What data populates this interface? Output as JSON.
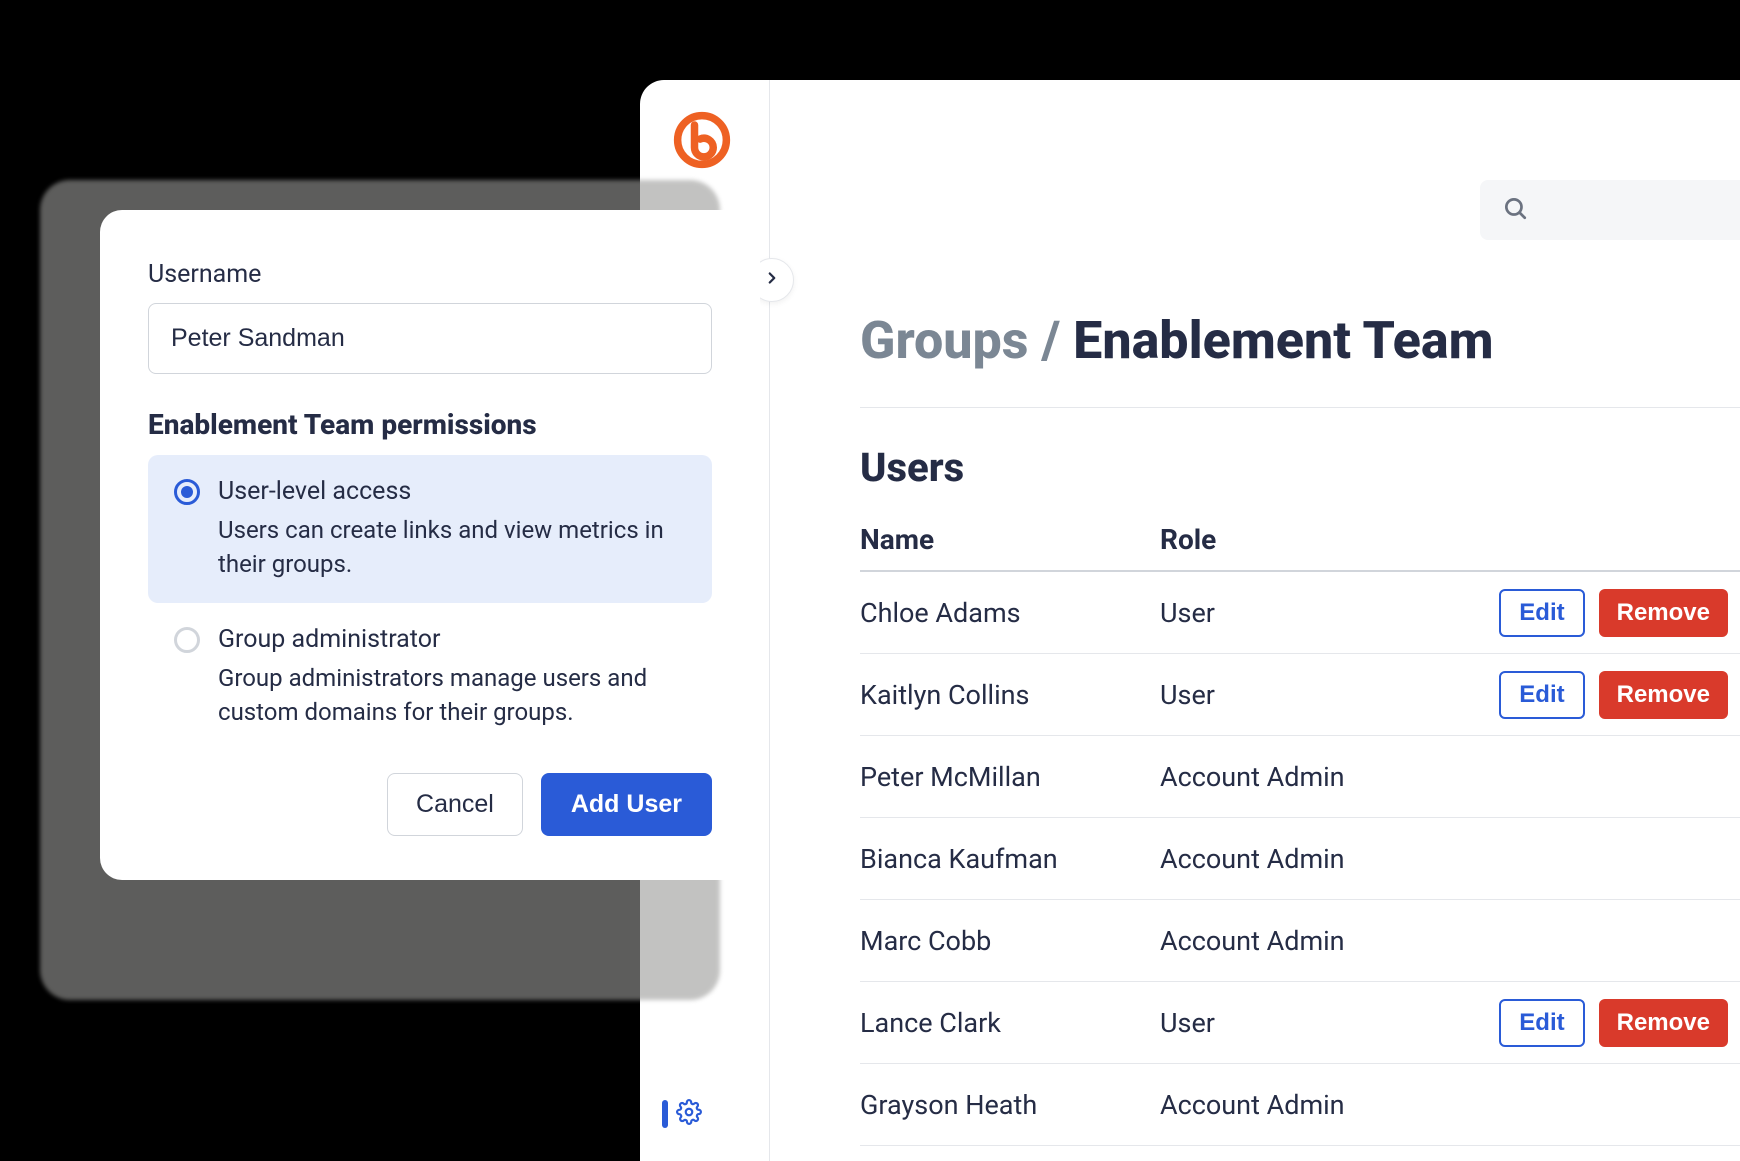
{
  "breadcrumb": {
    "root": "Groups",
    "sep": "/",
    "current": "Enablement Team"
  },
  "section_title": "Users",
  "table": {
    "headers": {
      "name": "Name",
      "role": "Role"
    },
    "edit_label": "Edit",
    "remove_label": "Remove",
    "rows": [
      {
        "name": "Chloe Adams",
        "role": "User",
        "editable": true
      },
      {
        "name": "Kaitlyn Collins",
        "role": "User",
        "editable": true
      },
      {
        "name": "Peter McMillan",
        "role": "Account Admin",
        "editable": false
      },
      {
        "name": "Bianca Kaufman",
        "role": "Account Admin",
        "editable": false
      },
      {
        "name": "Marc Cobb",
        "role": "Account Admin",
        "editable": false
      },
      {
        "name": "Lance Clark",
        "role": "User",
        "editable": true
      },
      {
        "name": "Grayson Heath",
        "role": "Account Admin",
        "editable": false
      }
    ]
  },
  "modal": {
    "username_label": "Username",
    "username_value": "Peter Sandman",
    "permissions_heading": "Enablement Team permissions",
    "options": [
      {
        "title": "User-level access",
        "desc": "Users can create links and view metrics in their groups.",
        "selected": true
      },
      {
        "title": "Group administrator",
        "desc": "Group administrators manage users and custom domains for their groups.",
        "selected": false
      }
    ],
    "cancel_label": "Cancel",
    "submit_label": "Add User"
  },
  "colors": {
    "primary": "#2a5bd7",
    "danger": "#d93a2b",
    "brand": "#ee6123",
    "text": "#252c45"
  }
}
